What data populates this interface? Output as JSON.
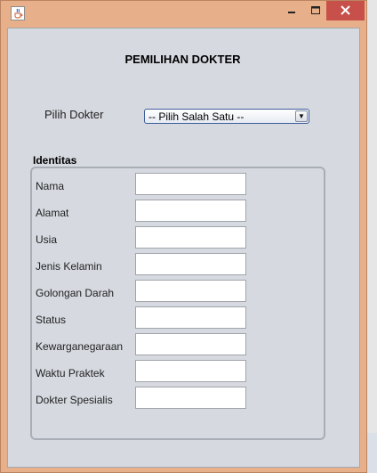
{
  "window": {
    "frame_color": "#e8b08a",
    "close_color": "#c7504a",
    "background": "#d6d9e0"
  },
  "form": {
    "title": "PEMILIHAN DOKTER",
    "doctor_label": "Pilih Dokter",
    "doctor_select": "-- Pilih Salah Satu --",
    "identity_title": "Identitas",
    "fields": [
      {
        "label": "Nama",
        "value": ""
      },
      {
        "label": "Alamat",
        "value": ""
      },
      {
        "label": "Usia",
        "value": ""
      },
      {
        "label": "Jenis Kelamin",
        "value": ""
      },
      {
        "label": "Golongan Darah",
        "value": ""
      },
      {
        "label": "Status",
        "value": ""
      },
      {
        "label": "Kewarganegaraan",
        "value": ""
      },
      {
        "label": "Waktu Praktek",
        "value": ""
      },
      {
        "label": "Dokter Spesialis",
        "value": ""
      }
    ]
  },
  "icons": {
    "app": "java-cup-icon",
    "minimize": "minimize-icon",
    "maximize": "maximize-icon",
    "close": "close-icon"
  }
}
